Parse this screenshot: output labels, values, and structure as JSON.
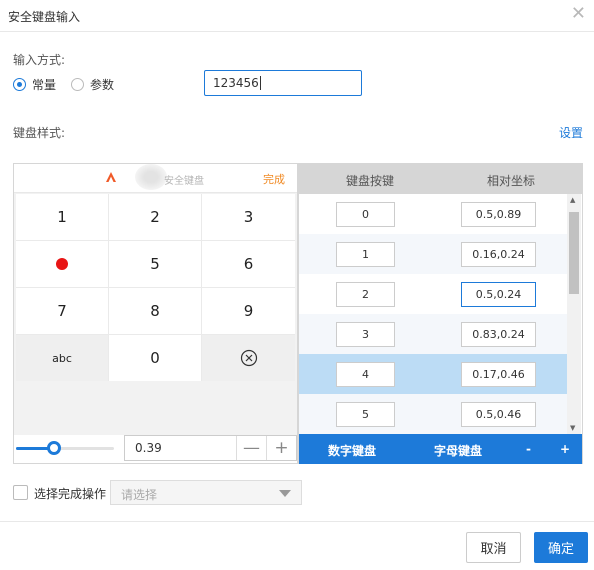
{
  "dialog": {
    "title": "安全键盘输入",
    "close_icon": "close-icon"
  },
  "input_mode": {
    "label": "输入方式:",
    "options": [
      {
        "label": "常量",
        "selected": true
      },
      {
        "label": "参数",
        "selected": false
      }
    ],
    "value": "123456"
  },
  "style": {
    "label": "键盘样式:",
    "settings_link": "设置"
  },
  "keyboard": {
    "brand_text": "安全键盘",
    "done_label": "完成",
    "keys": [
      {
        "label": "1"
      },
      {
        "label": "2"
      },
      {
        "label": "3"
      },
      {
        "label": ""
      },
      {
        "label": "5"
      },
      {
        "label": "6"
      },
      {
        "label": "7"
      },
      {
        "label": "8"
      },
      {
        "label": "9"
      },
      {
        "label": "abc"
      },
      {
        "label": "0"
      },
      {
        "label": ""
      }
    ],
    "slider_value": "0.39",
    "slider_fraction": 0.39,
    "minus_label": "—",
    "plus_label": "+"
  },
  "table": {
    "headers": [
      "键盘按键",
      "相对坐标"
    ],
    "rows": [
      {
        "key": "0",
        "coord": "0.5,0.89"
      },
      {
        "key": "1",
        "coord": "0.16,0.24"
      },
      {
        "key": "2",
        "coord": "0.5,0.24"
      },
      {
        "key": "3",
        "coord": "0.83,0.24"
      },
      {
        "key": "4",
        "coord": "0.17,0.46"
      },
      {
        "key": "5",
        "coord": "0.5,0.46"
      }
    ],
    "selected_row": 4,
    "footer": {
      "numeric_tab": "数字键盘",
      "alpha_tab": "字母键盘",
      "remove_label": "-",
      "add_label": "+"
    }
  },
  "finish_action": {
    "checkbox_label": "选择完成操作",
    "select_placeholder": "请选择"
  },
  "buttons": {
    "cancel": "取消",
    "ok": "确定"
  },
  "colors": {
    "accent": "#1d7ad9",
    "done": "#f08a24",
    "marker": "#e81515"
  }
}
